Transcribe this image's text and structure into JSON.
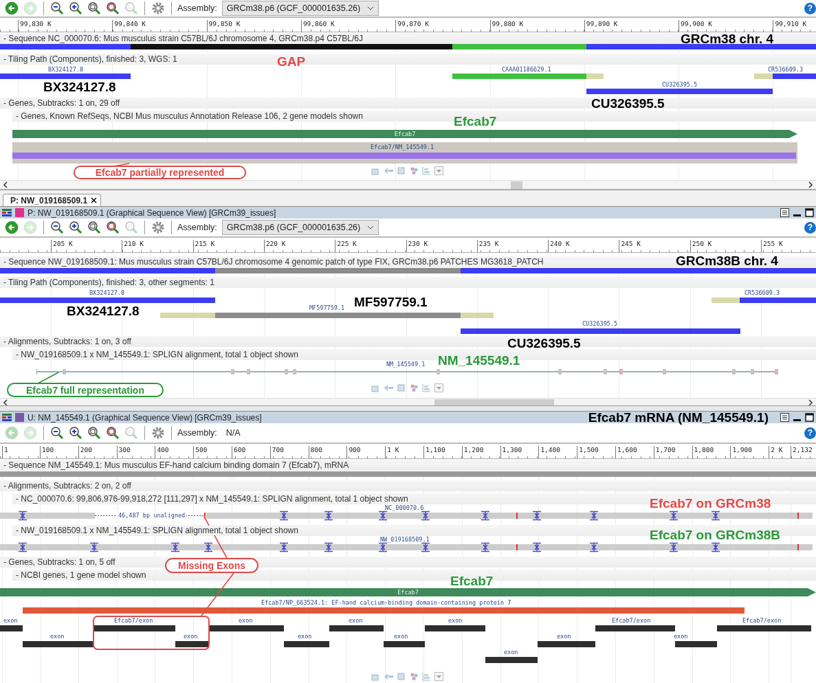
{
  "panels": [
    {
      "toolbar": {
        "tools": [
          {
            "kind": "back",
            "disabled": false
          },
          {
            "kind": "forward",
            "disabled": true
          },
          {
            "kind": "zoom-out",
            "disabled": false
          },
          {
            "kind": "zoom-in",
            "disabled": false
          },
          {
            "kind": "zoom-fit",
            "disabled": false
          },
          {
            "kind": "zoom-marker",
            "disabled": false
          },
          {
            "kind": "zoom-selection",
            "disabled": true
          },
          {
            "kind": "settings",
            "disabled": false
          }
        ],
        "assembly_label": "Assembly:",
        "assembly": {
          "kind": "dropdown",
          "value": "GRCm38.p6 (GCF_000001635.26)"
        },
        "help": "?"
      },
      "ruler": [
        "99,830 K",
        "99,840 K",
        "99,850 K",
        "99,860 K",
        "99,870 K",
        "99,880 K",
        "99,890 K",
        "99,900 K",
        "99,910 K"
      ],
      "items": [
        {
          "kind": "track-title",
          "text": "- Sequence NC_000070.6: Mus musculus strain C57BL/6J chromosome 4, GRCm38.p4 C57BL/6J"
        },
        {
          "kind": "sequence",
          "segments": [
            {
              "color": "#3c3cf2"
            },
            {
              "color": "#121212"
            },
            {
              "color": "#40c040"
            },
            {
              "color": "#3c3cf2"
            }
          ]
        },
        {
          "kind": "annotation",
          "text": "GRCm38 chr. 4",
          "color": "#000000"
        },
        {
          "kind": "track-title",
          "text": "- Tiling Path (Components), finished: 3, WGS: 1"
        },
        {
          "kind": "annotation",
          "text": "GAP",
          "color": "#e84848"
        },
        {
          "kind": "feature",
          "label": "BX324127.8",
          "segments": [
            {
              "color": "#3c3cf2"
            }
          ]
        },
        {
          "kind": "feature",
          "label": "CAAA01186629.1",
          "segments": [
            {
              "color": "#40c040"
            },
            {
              "color": "#d8d8a8"
            }
          ]
        },
        {
          "kind": "feature",
          "label": "CR536609.3",
          "segments": [
            {
              "color": "#d8d8a8"
            },
            {
              "color": "#3c3cf2"
            }
          ]
        },
        {
          "kind": "feature",
          "label": "CU326395.5",
          "segments": [
            {
              "color": "#3c3cf2"
            }
          ]
        },
        {
          "kind": "annotation",
          "text": "BX324127.8",
          "color": "#000000"
        },
        {
          "kind": "annotation",
          "text": "CU326395.5",
          "color": "#000000"
        },
        {
          "kind": "track-title",
          "text": "- Genes, Subtracks: 1 on, 29 off"
        },
        {
          "kind": "subtrack-title",
          "text": "- Genes, Known RefSeqs, NCBI Mus musculus Annotation Release 106, 2 gene models shown"
        },
        {
          "kind": "annotation",
          "text": "Efcab7",
          "color": "#2a9a3a"
        },
        {
          "kind": "gene",
          "label": "Efcab7"
        },
        {
          "kind": "transcript",
          "label": "Efcab7/NM_145549.1"
        },
        {
          "kind": "callout",
          "text": "Efcab7 partially represented",
          "color": "#e04848"
        }
      ]
    },
    {
      "tabs": [
        {
          "label": "P: NW_019168509.1",
          "selected": true
        }
      ],
      "header": {
        "title": "P: NW_019168509.1 (Graphical Sequence View) [GRCm39_issues]",
        "color": "#e0308a"
      },
      "toolbar": {
        "tools": [
          {
            "kind": "back",
            "disabled": false
          },
          {
            "kind": "forward",
            "disabled": true
          },
          {
            "kind": "zoom-out",
            "disabled": false
          },
          {
            "kind": "zoom-in",
            "disabled": false
          },
          {
            "kind": "zoom-fit",
            "disabled": false
          },
          {
            "kind": "zoom-marker",
            "disabled": false
          },
          {
            "kind": "zoom-selection",
            "disabled": true
          },
          {
            "kind": "settings",
            "disabled": false
          }
        ],
        "assembly_label": "Assembly:",
        "assembly": {
          "kind": "dropdown",
          "value": "GRCm38.p6 (GCF_000001635.26)"
        },
        "help": "?"
      },
      "ruler": [
        "205 K",
        "210 K",
        "215 K",
        "220 K",
        "225 K",
        "230 K",
        "235 K",
        "240 K",
        "245 K",
        "250 K",
        "255 K"
      ],
      "items": [
        {
          "kind": "track-title",
          "text": "- Sequence NW_019168509.1: Mus musculus strain C57BL/6J chromosome 4 genomic patch of type FIX, GRCm38.p6 PATCHES MG3618_PATCH"
        },
        {
          "kind": "sequence",
          "segments": [
            {
              "color": "#3c3cf2"
            },
            {
              "color": "#8c8c8c"
            },
            {
              "color": "#3c3cf2"
            }
          ]
        },
        {
          "kind": "annotation",
          "text": "GRCm38B chr. 4",
          "color": "#000000"
        },
        {
          "kind": "track-title",
          "text": "- Tiling Path (Components), finished: 3, other segments: 1"
        },
        {
          "kind": "feature",
          "label": "BX324127.8",
          "segments": [
            {
              "color": "#3c3cf2"
            }
          ]
        },
        {
          "kind": "feature",
          "label": "MF597759.1",
          "segments": [
            {
              "color": "#d8d8a8"
            },
            {
              "color": "#8c8c8c"
            },
            {
              "color": "#d8d8a8"
            }
          ]
        },
        {
          "kind": "feature",
          "label": "CR536609.3",
          "segments": [
            {
              "color": "#d8d8a8"
            },
            {
              "color": "#3c3cf2"
            }
          ]
        },
        {
          "kind": "feature",
          "label": "CU326395.5",
          "segments": [
            {
              "color": "#3c3cf2"
            }
          ]
        },
        {
          "kind": "annotation",
          "text": "BX324127.8",
          "color": "#000000"
        },
        {
          "kind": "annotation",
          "text": "MF597759.1",
          "color": "#000000"
        },
        {
          "kind": "annotation",
          "text": "CU326395.5",
          "color": "#000000"
        },
        {
          "kind": "track-title",
          "text": "- Alignments, Subtracks: 1 on, 3 off"
        },
        {
          "kind": "subtrack-title",
          "text": "- NW_019168509.1 x NM_145549.1: SPLIGN alignment, total 1 object shown"
        },
        {
          "kind": "alignment-line",
          "label": "NM_145549.1"
        },
        {
          "kind": "annotation",
          "text": "NM_145549.1",
          "color": "#2a9a3a"
        },
        {
          "kind": "callout",
          "text": "Efcab7 full representation",
          "color": "#2a9a3a"
        }
      ]
    },
    {
      "header": {
        "title": "U: NM_145549.1 (Graphical Sequence View) [GRCm39_issues]",
        "color": "#7a5aa8",
        "annotation": "Efcab7 mRNA (NM_145549.1)"
      },
      "toolbar": {
        "tools": [
          {
            "kind": "back",
            "disabled": true
          },
          {
            "kind": "forward",
            "disabled": true
          },
          {
            "kind": "zoom-out",
            "disabled": false
          },
          {
            "kind": "zoom-in",
            "disabled": false
          },
          {
            "kind": "zoom-fit",
            "disabled": false
          },
          {
            "kind": "zoom-marker",
            "disabled": false
          },
          {
            "kind": "zoom-selection",
            "disabled": true
          },
          {
            "kind": "settings",
            "disabled": false
          }
        ],
        "assembly_label": "Assembly:",
        "assembly": {
          "kind": "text",
          "value": "N/A"
        },
        "help": "?"
      },
      "ruler": [
        "1",
        "100",
        "200",
        "300",
        "400",
        "500",
        "600",
        "700",
        "800",
        "900",
        "1 K",
        "1,100",
        "1,200",
        "1,300",
        "1,400",
        "1,500",
        "1,600",
        "1,700",
        "1,800",
        "1,900",
        "2 K",
        "2,132"
      ],
      "items": [
        {
          "kind": "track-title",
          "text": "- Sequence NM_145549.1: Mus musculus EF-hand calcium binding domain 7 (Efcab7), mRNA"
        },
        {
          "kind": "sequence",
          "segments": [
            {
              "color": "#9a9a9a"
            }
          ]
        },
        {
          "kind": "track-title",
          "text": "- Alignments, Subtracks: 2 on, 2 off"
        },
        {
          "kind": "subtrack-title",
          "text": "- NC_000070.6: 99,806,976-99,918,272 [111,297] x NM_145549.1: SPLIGN alignment, total 1 object shown"
        },
        {
          "kind": "alignment",
          "label": "NC_000070.6",
          "gap_label": "46,487 bp unaligned"
        },
        {
          "kind": "annotation",
          "text": "Efcab7 on GRCm38",
          "color": "#e84848"
        },
        {
          "kind": "subtrack-title",
          "text": "- NW_019168509.1 x NM_145549.1: SPLIGN alignment, total 1 object shown"
        },
        {
          "kind": "alignment",
          "label": "NW_019168509.1"
        },
        {
          "kind": "annotation",
          "text": "Efcab7 on GRCm38B",
          "color": "#2a9a3a"
        },
        {
          "kind": "track-title",
          "text": "- Genes, Subtracks: 1 on, 5 off"
        },
        {
          "kind": "subtrack-title",
          "text": "- NCBI genes, 1 gene model shown"
        },
        {
          "kind": "annotation",
          "text": "Efcab7",
          "color": "#2a9a3a"
        },
        {
          "kind": "gene",
          "label": "Efcab7"
        },
        {
          "kind": "protein",
          "label": "Efcab7/NP_663524.1: EF-hand calcium-binding domain-containing protein 7"
        },
        {
          "kind": "exon",
          "label": "exon"
        },
        {
          "kind": "exon",
          "label": "Efcab7/exon"
        },
        {
          "kind": "exon",
          "label": "exon"
        },
        {
          "kind": "exon",
          "label": "exon"
        },
        {
          "kind": "exon",
          "label": "exon"
        },
        {
          "kind": "exon",
          "label": "Efcab7/exon"
        },
        {
          "kind": "exon",
          "label": "Efcab7/exon"
        },
        {
          "kind": "exon",
          "label": "exon"
        },
        {
          "kind": "exon",
          "label": "exon"
        },
        {
          "kind": "exon",
          "label": "exon"
        },
        {
          "kind": "exon",
          "label": "exon"
        },
        {
          "kind": "exon",
          "label": "exon"
        },
        {
          "kind": "exon",
          "label": "exon"
        },
        {
          "kind": "exon",
          "label": "exon"
        },
        {
          "kind": "callout",
          "text": "Missing Exons",
          "color": "#e04848"
        }
      ]
    }
  ]
}
